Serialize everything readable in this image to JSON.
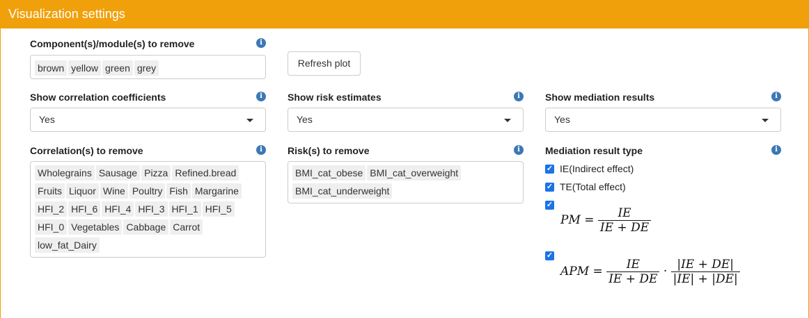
{
  "header": {
    "title": "Visualization settings"
  },
  "components": {
    "label": "Component(s)/module(s) to remove",
    "tags": [
      "brown",
      "yellow",
      "green",
      "grey"
    ]
  },
  "refresh_button": "Refresh plot",
  "show_correlation": {
    "label": "Show correlation coefficients",
    "value": "Yes"
  },
  "show_risk": {
    "label": "Show risk estimates",
    "value": "Yes"
  },
  "show_mediation": {
    "label": "Show mediation results",
    "value": "Yes"
  },
  "correlations": {
    "label": "Correlation(s) to remove",
    "tags": [
      "Wholegrains",
      "Sausage",
      "Pizza",
      "Refined.bread",
      "Fruits",
      "Liquor",
      "Wine",
      "Poultry",
      "Fish",
      "Margarine",
      "HFI_2",
      "HFI_6",
      "HFI_4",
      "HFI_3",
      "HFI_1",
      "HFI_5",
      "HFI_0",
      "Vegetables",
      "Cabbage",
      "Carrot",
      "low_fat_Dairy"
    ]
  },
  "risks": {
    "label": "Risk(s) to remove",
    "tags": [
      "BMI_cat_obese",
      "BMI_cat_overweight",
      "BMI_cat_underweight"
    ]
  },
  "mediation_type": {
    "label": "Mediation result type",
    "options": [
      {
        "label": "IE(Indirect effect)",
        "checked": true
      },
      {
        "label": "TE(Total effect)",
        "checked": true
      }
    ],
    "pm": {
      "lhs": "PM",
      "num": "IE",
      "den": "IE + DE",
      "checked": true
    },
    "apm": {
      "lhs": "APM",
      "num1": "IE",
      "den1": "IE + DE",
      "num2": "|IE + DE|",
      "den2": "|IE| + |DE|",
      "checked": true
    }
  },
  "icons": {
    "info": "info-circle-icon",
    "dropdown": "caret-down-icon",
    "check": "checkbox-checked-icon"
  },
  "colors": {
    "header": "#f0a00a",
    "info": "#3c78b5",
    "checkbox": "#1a73e8"
  }
}
